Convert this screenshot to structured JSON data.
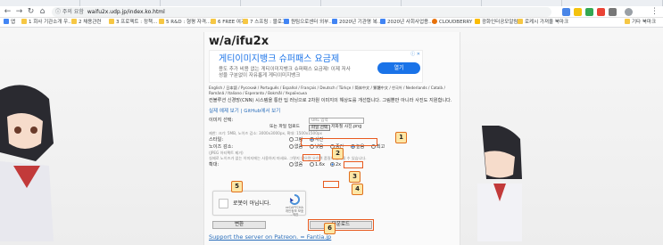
{
  "browser": {
    "address": "waifu2x.udp.jp/index.ko.html",
    "security_label": "ⓘ 주의 요함",
    "bookmarks": [
      "앱",
      "1 회사 기관소개 우...",
      "2 채용관련",
      "3 프로젝트 : 정책...",
      "5 R&D : 형평 자격...",
      "6 FREE 여가",
      "7 스프링 : 블로그",
      "원팀으로센터 외부...",
      "2020년 기관명 복...",
      "2020년 사회사업용...",
      "CLOUDBERRY",
      "광화인터공모알림",
      "로케시 가져올 북마크",
      "기타 북마크"
    ]
  },
  "header": {
    "logo": "w/a/ifu2x"
  },
  "ad": {
    "title": "게티이미지뱅크 슈퍼패스 요금제",
    "desc": "용도 추가 비용 없는 게티이미지뱅크 슈퍼패스 요금제! 이제 저사성을 구분없이 자유롭게 게티이미지뱅크",
    "button": "열기",
    "close": "ⓘ ✕"
  },
  "languages": "English / 日本語 / Русский / Português / Español / Français / Deutsch / Türkçe / 简体中文 / 繁體中文 / 한국어 / Nederlands / Català / Română / Italiano / Esperanto / Bokmål / Українська",
  "description": "컨볼루션 신경망(CNN) 시스템을 통한 딥 러닝으로 2차원 이미지의 해상도를 개선합니다. 그림뿐만 아니라 사진도 지원합니다.",
  "links": "실제 예제 보기 | GitHub에서 보기",
  "form": {
    "image_select_label": "이미지 선택:",
    "url_placeholder": "URL 입력",
    "or_file": "또는 파일 업로드",
    "file_button": "파일 선택",
    "file_name": "저화질 사진.png",
    "limits": "제한: 크기: 5MB, 노이즈 감소: 3000x3000px, 확대: 1500x1500px",
    "style_label": "스타일:",
    "style_opts": [
      "그림",
      "사진"
    ],
    "noise_label": "노이즈 감소:",
    "noise_hint": "(JPEG 아티팩트 제거)",
    "noise_opts": [
      "없음",
      "낮음",
      "중간",
      "높음",
      "최고"
    ],
    "noise_note": "실제로 노이즈가 없는 이미지에는 사용하지 마세요. 그렇지 않으면 오히려 품질이 떨어질 수 있습니다.",
    "scale_label": "확대:",
    "scale_opts": [
      "없음",
      "1.6x",
      "2x"
    ],
    "captcha": "로봇이 아닙니다.",
    "recaptcha": "reCAPTCHA 개인정보 보호 - 약관",
    "convert_button": "변환",
    "download_button": "다운로드",
    "support": "Support the server on Patreon. = Fantia.jp"
  },
  "annotations": [
    "1",
    "2",
    "3",
    "4",
    "5",
    "6"
  ],
  "colors": {
    "accent": "#1a73e8",
    "highlight": "#e85a1f",
    "badge_fill": "#fde7a6"
  }
}
